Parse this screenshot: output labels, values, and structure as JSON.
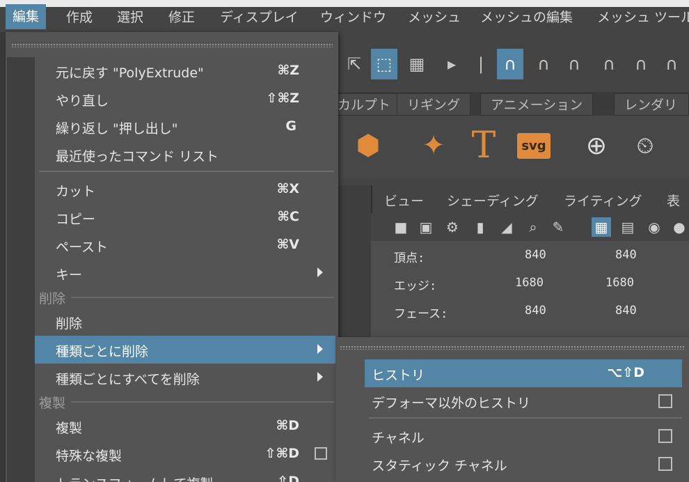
{
  "menubar": {
    "items": [
      "編集",
      "作成",
      "選択",
      "修正",
      "ディスプレイ",
      "ウィンドウ",
      "メッシュ",
      "メッシュの編集",
      "メッシュ ツール"
    ]
  },
  "shelf_tabs": [
    "カルプト",
    "リギング",
    "アニメーション",
    "レンダリン"
  ],
  "shelf_icons": {
    "text_tool": "T",
    "svg_tool": "svg"
  },
  "viewport": {
    "menu": [
      "ビュー",
      "シェーディング",
      "ライティング",
      "表示"
    ],
    "hud": [
      {
        "label": "頂点:",
        "v1": "840",
        "v2": "840"
      },
      {
        "label": "エッジ:",
        "v1": "1680",
        "v2": "1680"
      },
      {
        "label": "フェース:",
        "v1": "840",
        "v2": "840"
      }
    ]
  },
  "edit_menu": {
    "items": [
      {
        "label": "元に戻す \"PolyExtrude\"",
        "shortcut": "⌘Z"
      },
      {
        "label": "やり直し",
        "shortcut": "⇧⌘Z"
      },
      {
        "label": "繰り返し \"押し出し\"",
        "shortcut": "G"
      },
      {
        "label": "最近使ったコマンド リスト",
        "shortcut": ""
      },
      {
        "label": "カット",
        "shortcut": "⌘X"
      },
      {
        "label": "コピー",
        "shortcut": "⌘C"
      },
      {
        "label": "ペースト",
        "shortcut": "⌘V"
      },
      {
        "label": "キー",
        "shortcut": ""
      },
      {
        "label": "削除",
        "shortcut": ""
      },
      {
        "label": "種類ごとに削除",
        "shortcut": ""
      },
      {
        "label": "種類ごとにすべてを削除",
        "shortcut": ""
      },
      {
        "label": "複製",
        "shortcut": "⌘D"
      },
      {
        "label": "特殊な複製",
        "shortcut": "⇧⌘D"
      },
      {
        "label": "トランスフォームして複製",
        "shortcut": "⇧D"
      }
    ],
    "sections": {
      "delete": "削除",
      "duplicate": "複製"
    }
  },
  "delete_by_type_submenu": {
    "items": [
      {
        "label": "ヒストリ",
        "shortcut": "⌥⇧D"
      },
      {
        "label": "デフォーマ以外のヒストリ",
        "shortcut": ""
      },
      {
        "label": "チャネル",
        "shortcut": ""
      },
      {
        "label": "スタティック チャネル",
        "shortcut": ""
      }
    ]
  },
  "colors": {
    "highlight": "#5285a6",
    "menu_bg": "#545454",
    "accent_orange": "#e08a3c"
  }
}
